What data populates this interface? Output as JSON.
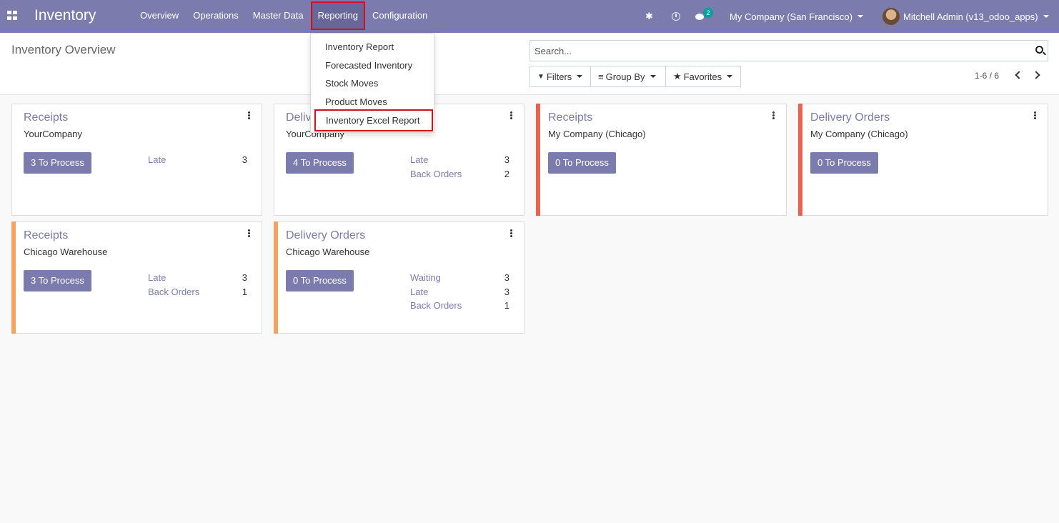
{
  "navbar": {
    "app_title": "Inventory",
    "menu": [
      "Overview",
      "Operations",
      "Master Data",
      "Reporting",
      "Configuration"
    ],
    "active_menu": "Reporting",
    "chat_badge": "2",
    "company": "My Company (San Francisco)",
    "user": "Mitchell Admin (v13_odoo_apps)",
    "color": "#7c7bad"
  },
  "reporting_dropdown": {
    "items": [
      "Inventory Report",
      "Forecasted Inventory",
      "Stock Moves",
      "Product Moves",
      "Inventory Excel Report"
    ],
    "highlighted": "Inventory Excel Report"
  },
  "control_panel": {
    "title": "Inventory Overview",
    "search_placeholder": "Search...",
    "filters_label": "Filters",
    "groupby_label": "Group By",
    "favorites_label": "Favorites",
    "pager": "1-6 / 6"
  },
  "cards": [
    {
      "title": "Receipts",
      "subtitle": "YourCompany",
      "button": "3 To Process",
      "stats": [
        {
          "label": "Late",
          "value": "3"
        }
      ],
      "bar_color": ""
    },
    {
      "title": "Deliv",
      "subtitle": "YourCompany",
      "button": "4 To Process",
      "stats": [
        {
          "label": "Late",
          "value": "3"
        },
        {
          "label": "Back Orders",
          "value": "2"
        }
      ],
      "bar_color": ""
    },
    {
      "title": "Receipts",
      "subtitle": "My Company (Chicago)",
      "button": "0 To Process",
      "stats": [],
      "bar_color": "#ea6350"
    },
    {
      "title": "Delivery Orders",
      "subtitle": "My Company (Chicago)",
      "button": "0 To Process",
      "stats": [],
      "bar_color": "#ea6350"
    },
    {
      "title": "Receipts",
      "subtitle": "Chicago Warehouse",
      "button": "3 To Process",
      "stats": [
        {
          "label": "Late",
          "value": "3"
        },
        {
          "label": "Back Orders",
          "value": "1"
        }
      ],
      "bar_color": "#f4a460"
    },
    {
      "title": "Delivery Orders",
      "subtitle": "Chicago Warehouse",
      "button": "0 To Process",
      "stats": [
        {
          "label": "Waiting",
          "value": "3"
        },
        {
          "label": "Late",
          "value": "3"
        },
        {
          "label": "Back Orders",
          "value": "1"
        }
      ],
      "bar_color": "#f4a460"
    }
  ]
}
